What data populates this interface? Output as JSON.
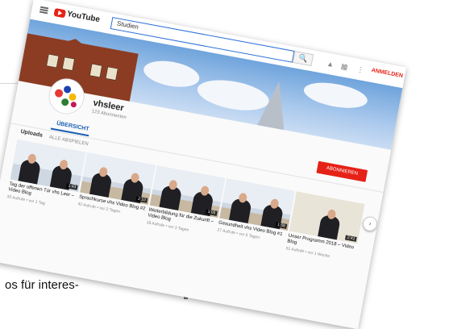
{
  "page": {
    "fragment_text": "os für interes-"
  },
  "topbar": {
    "logo_text": "YouTube",
    "search_value": "Studien",
    "signin_label": "ANMELDEN",
    "icons": [
      "menu-icon",
      "youtube-logo-icon",
      "search-icon",
      "upload-icon",
      "apps-icon",
      "more-icon"
    ]
  },
  "channel": {
    "name": "vhsleer",
    "subscribers": "123 Abonnenten",
    "tab_label": "ÜBERSICHT",
    "subscribe_label": "ABONNIEREN",
    "section_title": "Uploads",
    "play_all_label": "ALLE ABSPIELEN"
  },
  "videos": [
    {
      "title": "Tag der offenen Tür vhs Leer – Video Blog",
      "meta": "35 Aufrufe • vor 1 Tag",
      "duration": "1:43"
    },
    {
      "title": "Sprachkurse vhs Video Blog #2",
      "meta": "42 Aufrufe • vor 2 Tagen",
      "duration": "2:10"
    },
    {
      "title": "Weiterbildung für die Zukunft – Video Blog",
      "meta": "18 Aufrufe • vor 3 Tagen",
      "duration": "3:05"
    },
    {
      "title": "Gesundheit vhs Video Blog #1",
      "meta": "27 Aufrufe • vor 5 Tagen",
      "duration": "1:58"
    },
    {
      "title": "Unser Programm 2018 – Video Blog",
      "meta": "51 Aufrufe • vor 1 Woche",
      "duration": "2:41"
    }
  ],
  "colors": {
    "brand_red": "#e62117",
    "link_blue": "#1a5fb4"
  }
}
